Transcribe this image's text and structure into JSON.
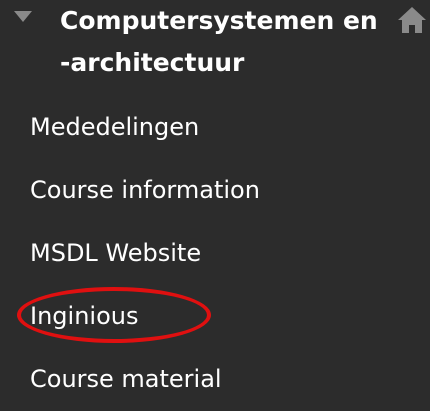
{
  "course": {
    "title_line1": "Computersystemen en",
    "title_line2": "-architectuur",
    "toggle_icon": "caret-down-icon",
    "home_icon": "home-icon"
  },
  "menu": {
    "items": [
      {
        "label": "Mededelingen"
      },
      {
        "label": "Course information"
      },
      {
        "label": "MSDL Website"
      },
      {
        "label": "Inginious",
        "highlighted": true
      },
      {
        "label": "Course material"
      }
    ]
  },
  "colors": {
    "background": "#2c2c2c",
    "text": "#ffffff",
    "icon": "#8a8a8a",
    "highlight": "#e01010"
  }
}
